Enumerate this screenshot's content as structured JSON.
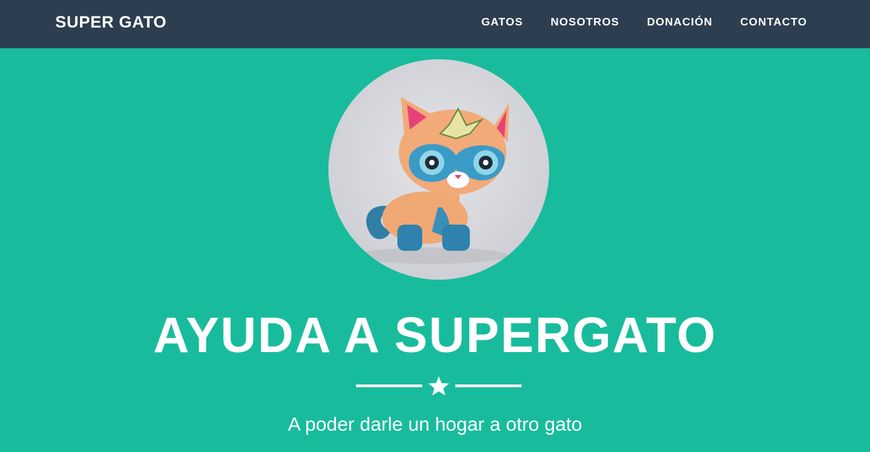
{
  "navbar": {
    "brand": "SUPER GATO",
    "links": [
      {
        "label": "GATOS"
      },
      {
        "label": "NOSOTROS"
      },
      {
        "label": "DONACIÓN"
      },
      {
        "label": "CONTACTO"
      }
    ]
  },
  "hero": {
    "image_icon": "superhero-cat-toy-image",
    "title": "AYUDA A SUPERGATO",
    "divider_icon": "star-icon",
    "subtitle": "A poder darle un hogar a otro gato"
  },
  "colors": {
    "navbar_bg": "#2c3e50",
    "hero_bg": "#18bc9c",
    "text": "#ffffff"
  }
}
